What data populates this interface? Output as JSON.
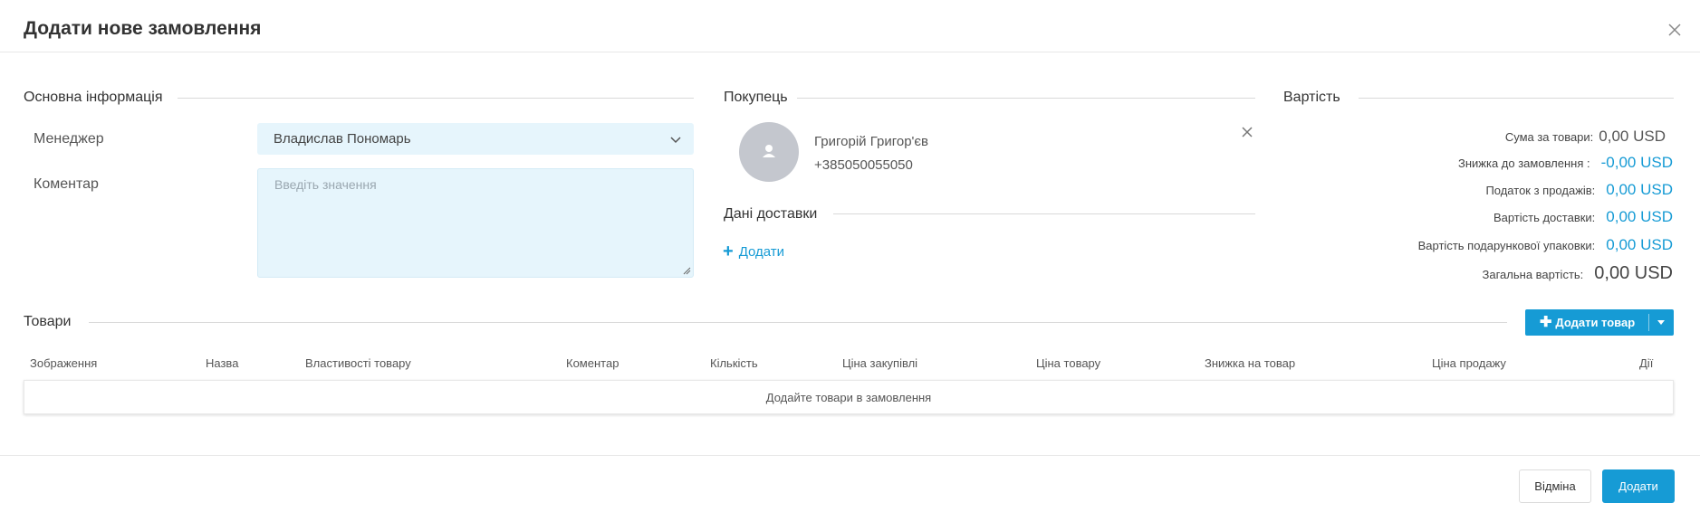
{
  "modal": {
    "title": "Додати нове замовлення"
  },
  "sections": {
    "main_info": "Основна інформація",
    "buyer": "Покупець",
    "cost": "Вартість",
    "delivery": "Дані доставки",
    "products": "Товари"
  },
  "form": {
    "manager_label": "Менеджер",
    "manager_value": "Владислав Пономарь",
    "comment_label": "Коментар",
    "comment_placeholder": "Введіть значення"
  },
  "buyer": {
    "name": "Григорій Григор'єв",
    "phone": "+385050055050"
  },
  "delivery": {
    "add_label": "Додати"
  },
  "cost": {
    "rows": [
      {
        "label": "Сума за товари:",
        "value": "0,00 USD"
      },
      {
        "label": "Знижка до замовлення :",
        "value": "-0,00 USD"
      },
      {
        "label": "Податок з продажів:",
        "value": "0,00 USD"
      },
      {
        "label": "Вартість доставки:",
        "value": "0,00 USD"
      },
      {
        "label": "Вартість подарункової упаковки:",
        "value": "0,00 USD"
      },
      {
        "label": "Загальна вартість:",
        "value": "0,00 USD"
      }
    ]
  },
  "products": {
    "add_button": "Додати товар",
    "columns": [
      "Зображення",
      "Назва",
      "Властивості товару",
      "Коментар",
      "Кількість",
      "Ціна закупівлі",
      "Ціна товару",
      "Знижка на товар",
      "Ціна продажу",
      "Дії"
    ],
    "empty_text": "Додайте товари в замовлення"
  },
  "footer": {
    "cancel": "Відміна",
    "submit": "Додати"
  },
  "colors": {
    "accent": "#169bd5",
    "input_bg": "#e6f5fc"
  },
  "icons": {
    "close": "close-icon",
    "chevron": "chevron-down-icon",
    "avatar": "user-icon",
    "remove": "close-icon",
    "plus": "plus-icon"
  }
}
